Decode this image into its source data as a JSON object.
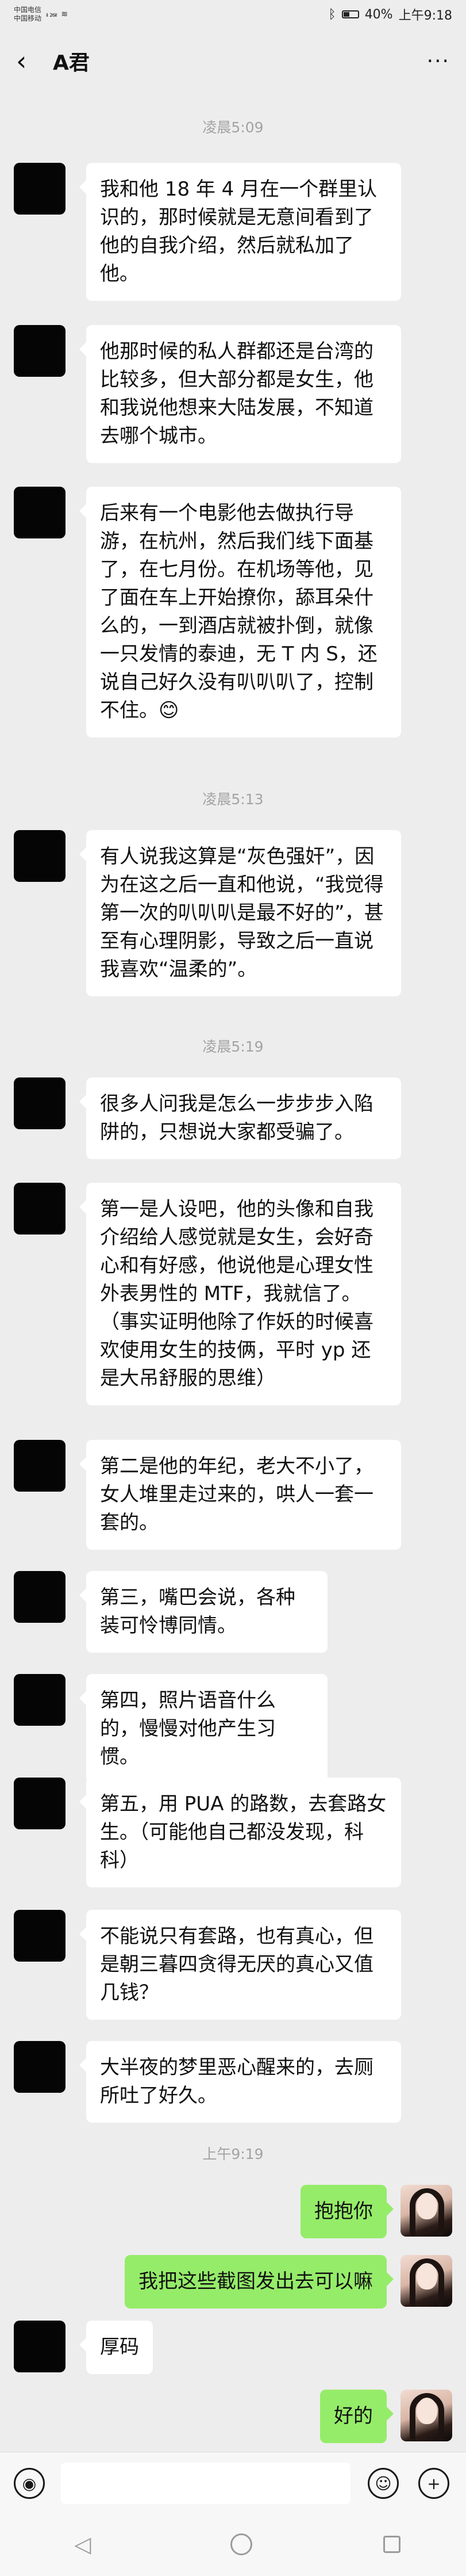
{
  "status_bar": {
    "carrier1": "中国电信",
    "carrier2": "中国移动",
    "signal": "ᵢₗ ₂₆ᵢₗ",
    "wifi": "≋",
    "bluetooth": "ᛒ",
    "battery": "40%",
    "time": "上午9:18"
  },
  "header": {
    "title": "A君",
    "back_icon": "‹",
    "more_icon": "···"
  },
  "timestamps": [
    "凌晨5:09",
    "凌晨5:13",
    "凌晨5:19",
    "上午9:19"
  ],
  "messages": [
    {
      "side": "left",
      "text": "我和他 18 年 4 月在一个群里认识的，那时候就是无意间看到了他的自我介绍，然后就私加了他。"
    },
    {
      "side": "left",
      "text": "他那时候的私人群都还是台湾的比较多，但大部分都是女生，他和我说他想来大陆发展，不知道去哪个城市。"
    },
    {
      "side": "left",
      "text": "后来有一个电影他去做执行导游，在杭州，然后我们线下面基了，在七月份。在机场等他，见了面在车上开始撩你，舔耳朵什么的，一到酒店就被扑倒，就像一只发情的泰迪，无 T 内 S，还说自己好久没有叭叭叭了，控制不住。😊"
    },
    {
      "side": "left",
      "text": "有人说我这算是“灰色强奸”，因为在这之后一直和他说，“我觉得第一次的叭叭叭是最不好的”，甚至有心理阴影，导致之后一直说我喜欢“温柔的”。"
    },
    {
      "side": "left",
      "text": "很多人问我是怎么一步步步入陷阱的，只想说大家都受骗了。"
    },
    {
      "side": "left",
      "text": "第一是人设吧，他的头像和自我介绍给人感觉就是女生，会好奇心和有好感，他说他是心理女性外表男性的 MTF，我就信了。（事实证明他除了作妖的时候喜欢使用女生的技俩，平时 yp 还是大吊舒服的思维）"
    },
    {
      "side": "left",
      "text": "第二是他的年纪，老大不小了，女人堆里走过来的，哄人一套一套的。"
    },
    {
      "side": "left",
      "text": "第三，嘴巴会说，各种装可怜博同情。"
    },
    {
      "side": "left",
      "text": "第四，照片语音什么的，慢慢对他产生习惯。"
    },
    {
      "side": "left",
      "text": "第五，用 PUA 的路数，去套路女生。（可能他自己都没发现，科科）"
    },
    {
      "side": "left",
      "text": "不能说只有套路，也有真心，但是朝三暮四贪得无厌的真心又值几钱？"
    },
    {
      "side": "left",
      "text": "大半夜的梦里恶心醒来的，去厕所吐了好久。"
    },
    {
      "side": "right",
      "text": "抱抱你"
    },
    {
      "side": "right",
      "text": "我把这些截图发出去可以嘛"
    },
    {
      "side": "left",
      "text": "厚码"
    },
    {
      "side": "right",
      "text": "好的"
    }
  ],
  "input_bar": {
    "voice_icon": "◉",
    "emoji_icon": "☺",
    "plus_icon": "+"
  },
  "nav_bar": {
    "back_icon": "◁"
  }
}
